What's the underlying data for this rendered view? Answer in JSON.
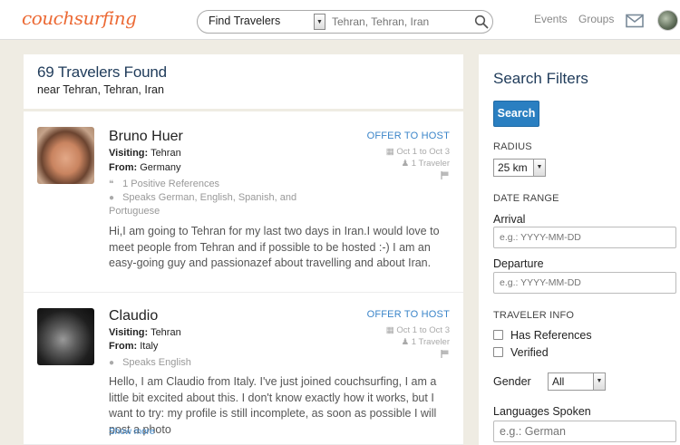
{
  "header": {
    "logo": "couchsurfing",
    "search_type": "Find Travelers",
    "search_placeholder": "Tehran, Tehran, Iran",
    "nav": [
      "Events",
      "Groups"
    ]
  },
  "results": {
    "count_title": "69 Travelers Found",
    "near": "near Tehran, Tehran, Iran",
    "items": [
      {
        "name": "Bruno Huer",
        "visiting_label": "Visiting:",
        "visiting": "Tehran",
        "from_label": "From:",
        "from": "Germany",
        "references": "1 Positive References",
        "speaks": "Speaks German, English, Spanish, and",
        "speaks_cont": "Portuguese",
        "offer": "OFFER TO HOST",
        "dates": "Oct 1 to Oct 3",
        "travelers": "1 Traveler",
        "bio": "Hi,I am going to Tehran for my last two days in Iran.I would love to meet people from Tehran and if possible to be hosted :-) I am an easy-going guy and passionazef about travelling and about Iran."
      },
      {
        "name": "Claudio",
        "visiting_label": "Visiting:",
        "visiting": "Tehran",
        "from_label": "From:",
        "from": "Italy",
        "speaks": "Speaks English",
        "offer": "OFFER TO HOST",
        "dates": "Oct 1 to Oct 3",
        "travelers": "1 Traveler",
        "bio": "Hello, I am Claudio from Italy. I've just joined couchsurfing, I am a little bit excited about this. I don't know exactly how it works, but I want to try: my profile is still incomplete, as soon as possible I will post a photo",
        "show_more": "Show more"
      }
    ]
  },
  "filters": {
    "title": "Search Filters",
    "search_button": "Search",
    "radius_heading": "RADIUS",
    "radius_value": "25 km",
    "date_heading": "DATE RANGE",
    "arrival_label": "Arrival",
    "arrival_placeholder": "e.g.: YYYY-MM-DD",
    "departure_label": "Departure",
    "departure_placeholder": "e.g.: YYYY-MM-DD",
    "traveler_heading": "TRAVELER INFO",
    "has_references": "Has References",
    "verified": "Verified",
    "gender_label": "Gender",
    "gender_value": "All",
    "languages_label": "Languages Spoken",
    "languages_placeholder": "e.g.: German"
  },
  "colors": {
    "brand": "#ec6a35",
    "link": "#3b85c9",
    "button": "#2a7fc1",
    "heading": "#1f3b5a",
    "page_bg": "#efece3"
  }
}
